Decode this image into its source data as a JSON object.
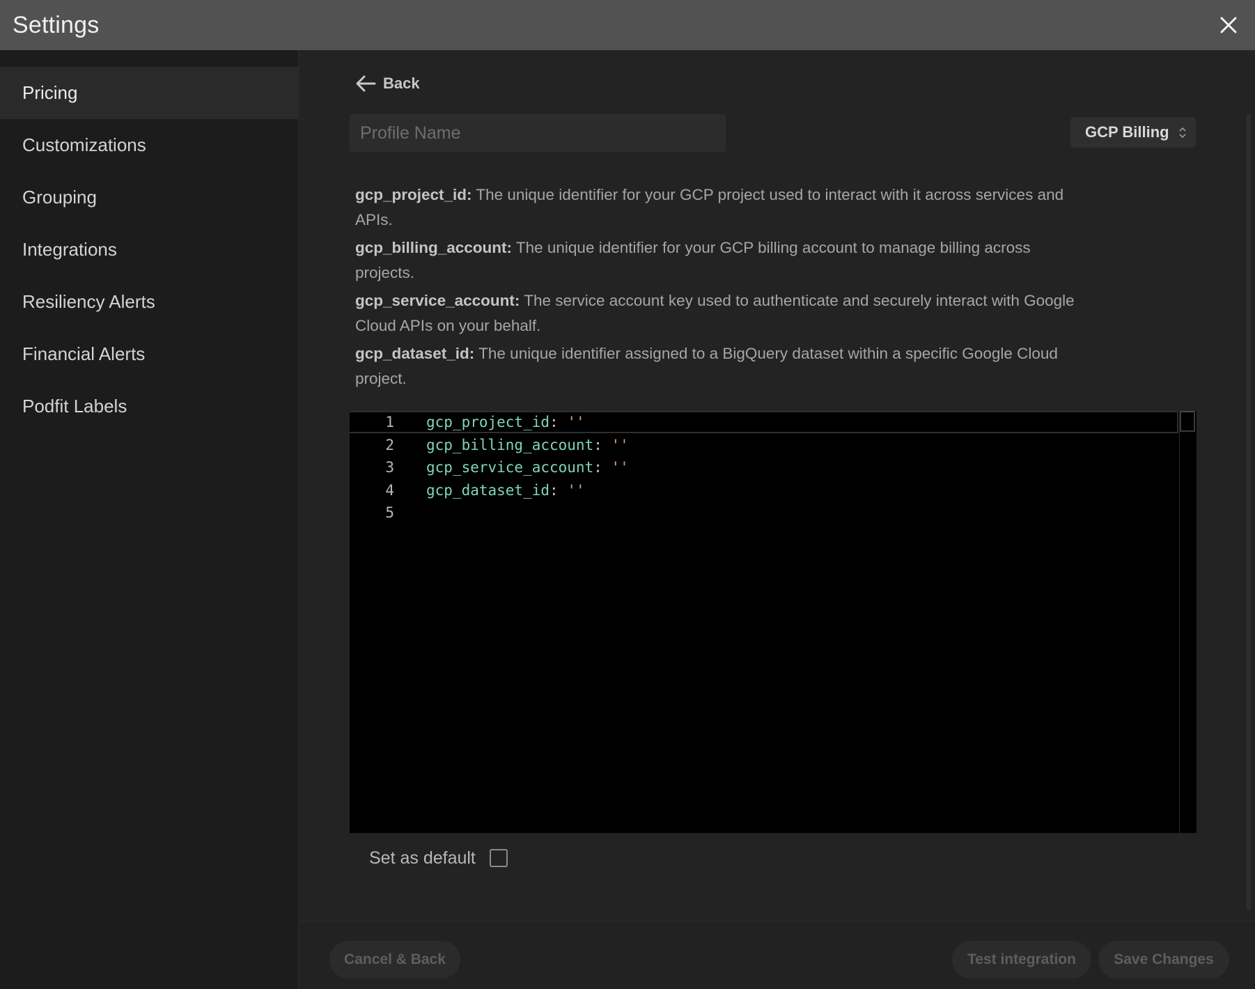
{
  "window": {
    "title": "Settings"
  },
  "sidebar": {
    "items": [
      {
        "label": "Pricing",
        "active": true
      },
      {
        "label": "Customizations"
      },
      {
        "label": "Grouping"
      },
      {
        "label": "Integrations"
      },
      {
        "label": "Resiliency Alerts"
      },
      {
        "label": "Financial Alerts"
      },
      {
        "label": "Podfit Labels"
      }
    ]
  },
  "main": {
    "back_label": "Back",
    "profile_name": {
      "value": "",
      "placeholder": "Profile Name"
    },
    "integration_type": {
      "selected": "GCP Billing"
    },
    "descriptions": [
      {
        "key": "gcp_project_id:",
        "text": " The unique identifier for your GCP project used to interact with it across services and APIs."
      },
      {
        "key": "gcp_billing_account:",
        "text": " The unique identifier for your GCP billing account to manage billing across projects."
      },
      {
        "key": "gcp_service_account:",
        "text": " The service account key used to authenticate and securely interact with Google Cloud APIs on your behalf."
      },
      {
        "key": "gcp_dataset_id:",
        "text": " The unique identifier assigned to a BigQuery dataset within a specific Google Cloud project."
      }
    ],
    "editor": {
      "lines": [
        {
          "num": "1",
          "key": "gcp_project_id",
          "colon": ":",
          "value": " ''"
        },
        {
          "num": "2",
          "key": "gcp_billing_account",
          "colon": ":",
          "value": " ''"
        },
        {
          "num": "3",
          "key": "gcp_service_account",
          "colon": ":",
          "value": " ''"
        },
        {
          "num": "4",
          "key": "gcp_dataset_id",
          "colon": ":",
          "value": " ''"
        },
        {
          "num": "5",
          "key": "",
          "colon": "",
          "value": ""
        }
      ],
      "colors": {
        "key": "#7fd6b8",
        "string": "#e0a070"
      }
    },
    "set_default_label": "Set as default",
    "set_default_checked": false
  },
  "footer": {
    "cancel_label": "Cancel & Back",
    "test_label": "Test integration",
    "save_label": "Save Changes"
  }
}
